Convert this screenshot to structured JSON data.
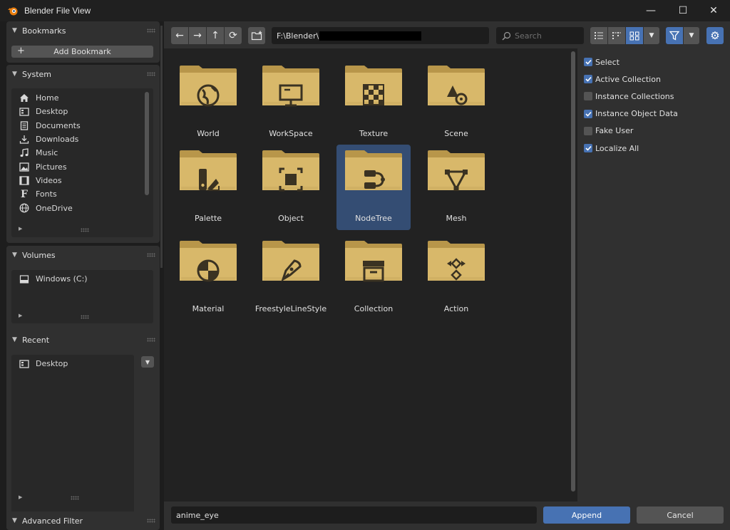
{
  "window": {
    "title": "Blender File View",
    "minimize_label": "—",
    "maximize_label": "☐",
    "close_label": "✕"
  },
  "sidebar": {
    "bookmarks": {
      "title": "Bookmarks",
      "add_label": "Add Bookmark"
    },
    "system": {
      "title": "System",
      "items": [
        {
          "label": "Home",
          "icon": "home-icon"
        },
        {
          "label": "Desktop",
          "icon": "desktop-icon"
        },
        {
          "label": "Documents",
          "icon": "documents-icon"
        },
        {
          "label": "Downloads",
          "icon": "downloads-icon"
        },
        {
          "label": "Music",
          "icon": "music-icon"
        },
        {
          "label": "Pictures",
          "icon": "pictures-icon"
        },
        {
          "label": "Videos",
          "icon": "videos-icon"
        },
        {
          "label": "Fonts",
          "icon": "fonts-icon"
        },
        {
          "label": "OneDrive",
          "icon": "globe-icon"
        }
      ]
    },
    "volumes": {
      "title": "Volumes",
      "items": [
        {
          "label": "Windows (C:)",
          "icon": "drive-icon"
        }
      ]
    },
    "recent": {
      "title": "Recent",
      "items": [
        {
          "label": "Desktop",
          "icon": "desktop-icon"
        }
      ]
    },
    "advanced_filter": {
      "title": "Advanced Filter"
    }
  },
  "toolbar": {
    "path": "F:\\Blender\\",
    "search_placeholder": "Search"
  },
  "files": [
    {
      "label": "World",
      "icon": "world-icon",
      "selected": false
    },
    {
      "label": "WorkSpace",
      "icon": "workspace-icon",
      "selected": false
    },
    {
      "label": "Texture",
      "icon": "texture-icon",
      "selected": false
    },
    {
      "label": "Scene",
      "icon": "scene-icon",
      "selected": false
    },
    {
      "label": "Palette",
      "icon": "palette-icon",
      "selected": false
    },
    {
      "label": "Object",
      "icon": "object-icon",
      "selected": false
    },
    {
      "label": "NodeTree",
      "icon": "nodetree-icon",
      "selected": true
    },
    {
      "label": "Mesh",
      "icon": "mesh-icon",
      "selected": false
    },
    {
      "label": "Material",
      "icon": "material-icon",
      "selected": false
    },
    {
      "label": "FreestyleLineStyle",
      "icon": "linestyle-icon",
      "selected": false
    },
    {
      "label": "Collection",
      "icon": "collection-icon",
      "selected": false
    },
    {
      "label": "Action",
      "icon": "action-icon",
      "selected": false
    }
  ],
  "options": [
    {
      "label": "Select",
      "checked": true
    },
    {
      "label": "Active Collection",
      "checked": true
    },
    {
      "label": "Instance Collections",
      "checked": false
    },
    {
      "label": "Instance Object Data",
      "checked": true
    },
    {
      "label": "Fake User",
      "checked": false
    },
    {
      "label": "Localize All",
      "checked": true
    }
  ],
  "bottom": {
    "filename": "anime_eye",
    "append_label": "Append",
    "cancel_label": "Cancel"
  },
  "colors": {
    "accent": "#4772b3",
    "folder": "#d8b86a",
    "folder_dark": "#b8964a",
    "selected_tile": "#344d73"
  }
}
